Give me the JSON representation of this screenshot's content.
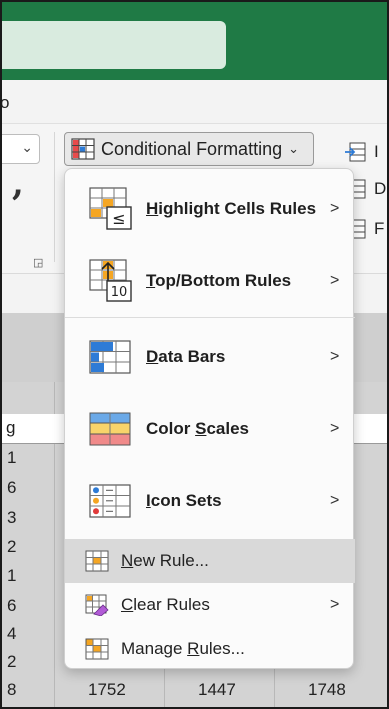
{
  "menustrip": {
    "partial_text": "o"
  },
  "ribbon": {
    "conditional_formatting": "Conditional Formatting",
    "comma": ",",
    "right_items": [
      {
        "text": "I"
      },
      {
        "text": "D"
      },
      {
        "text": "F"
      }
    ]
  },
  "sheet": {
    "header_partial": "g",
    "row_values": [
      "1",
      "6",
      "3",
      "2",
      "1",
      "6",
      "4",
      "2",
      "8"
    ],
    "bottom_values": [
      "1752",
      "1447",
      "1748"
    ]
  },
  "menu": {
    "items_big": [
      {
        "label_pre": "",
        "label_u": "H",
        "label_post": "ighlight Cells Rules",
        "icon": "highlight-cells-icon"
      },
      {
        "label_pre": "",
        "label_u": "T",
        "label_post": "op/Bottom Rules",
        "icon": "top-bottom-icon",
        "icon_text": "10"
      },
      {
        "label_pre": "",
        "label_u": "D",
        "label_post": "ata Bars",
        "icon": "data-bars-icon"
      },
      {
        "label_pre": "Color ",
        "label_u": "S",
        "label_post": "cales",
        "icon": "color-scales-icon"
      },
      {
        "label_pre": "",
        "label_u": "I",
        "label_post": "con Sets",
        "icon": "icon-sets-icon"
      }
    ],
    "items_small": [
      {
        "label_pre": "",
        "label_u": "N",
        "label_post": "ew Rule...",
        "icon": "new-rule-icon"
      },
      {
        "label_pre": "",
        "label_u": "C",
        "label_post": "lear Rules",
        "icon": "clear-rules-icon"
      },
      {
        "label_pre": "Manage ",
        "label_u": "R",
        "label_post": "ules...",
        "icon": "manage-rules-icon"
      }
    ],
    "highlight_symbol": "≤"
  },
  "colors": {
    "titlebar": "#1f7a45",
    "accent_orange": "#f5a623",
    "accent_blue": "#2e7bd6"
  }
}
